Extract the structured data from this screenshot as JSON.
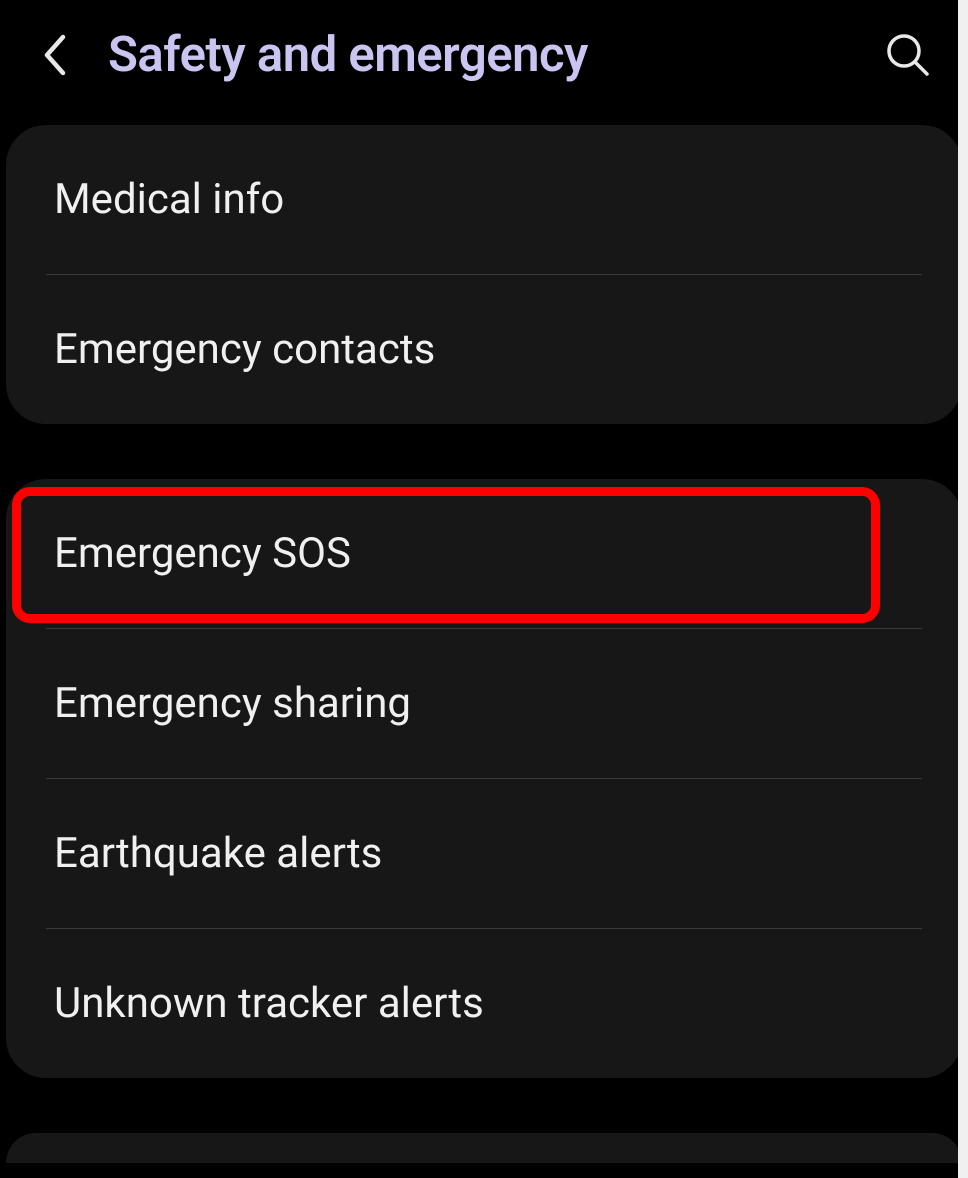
{
  "header": {
    "title": "Safety and emergency"
  },
  "group1": {
    "items": [
      {
        "label": "Medical info"
      },
      {
        "label": "Emergency contacts"
      }
    ]
  },
  "group2": {
    "items": [
      {
        "label": "Emergency SOS",
        "highlighted": true
      },
      {
        "label": "Emergency sharing"
      },
      {
        "label": "Earthquake alerts"
      },
      {
        "label": "Unknown tracker alerts"
      }
    ]
  }
}
